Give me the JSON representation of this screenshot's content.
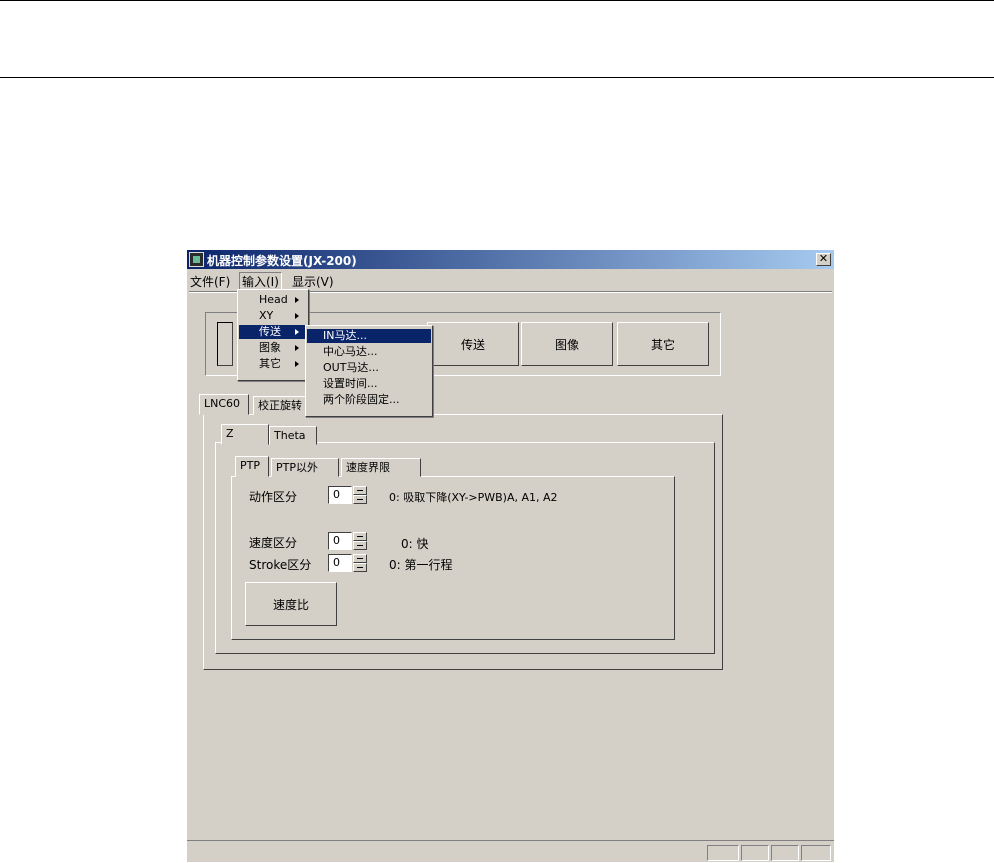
{
  "window": {
    "title": "机器控制参数设置(JX-200)",
    "close_glyph": "✕"
  },
  "menubar": {
    "file": "文件(F)",
    "input": "输入(I)",
    "display": "显示(V)"
  },
  "input_menu": {
    "items": [
      "Head",
      "XY",
      "传送",
      "图象",
      "其它"
    ]
  },
  "transfer_submenu": {
    "items": [
      "IN马达...",
      "中心马达...",
      "OUT马达...",
      "设置时间...",
      "两个阶段固定..."
    ]
  },
  "top_buttons": {
    "transfer": "传送",
    "image": "图像",
    "other": "其它"
  },
  "outer_tabs": [
    "LNC60",
    "校正旋转"
  ],
  "axis_tabs": [
    "Z",
    "Theta"
  ],
  "mode_tabs": [
    "PTP",
    "PTP以外",
    "速度界限"
  ],
  "fields": {
    "action": {
      "label": "动作区分",
      "value": "0",
      "desc": "0: 吸取下降(XY->PWB)A, A1, A2"
    },
    "speed": {
      "label": "速度区分",
      "value": "0",
      "desc": "0: 快"
    },
    "stroke": {
      "label": "Stroke区分",
      "value": "0",
      "desc": "0: 第一行程"
    }
  },
  "speed_ratio_button": "速度比"
}
